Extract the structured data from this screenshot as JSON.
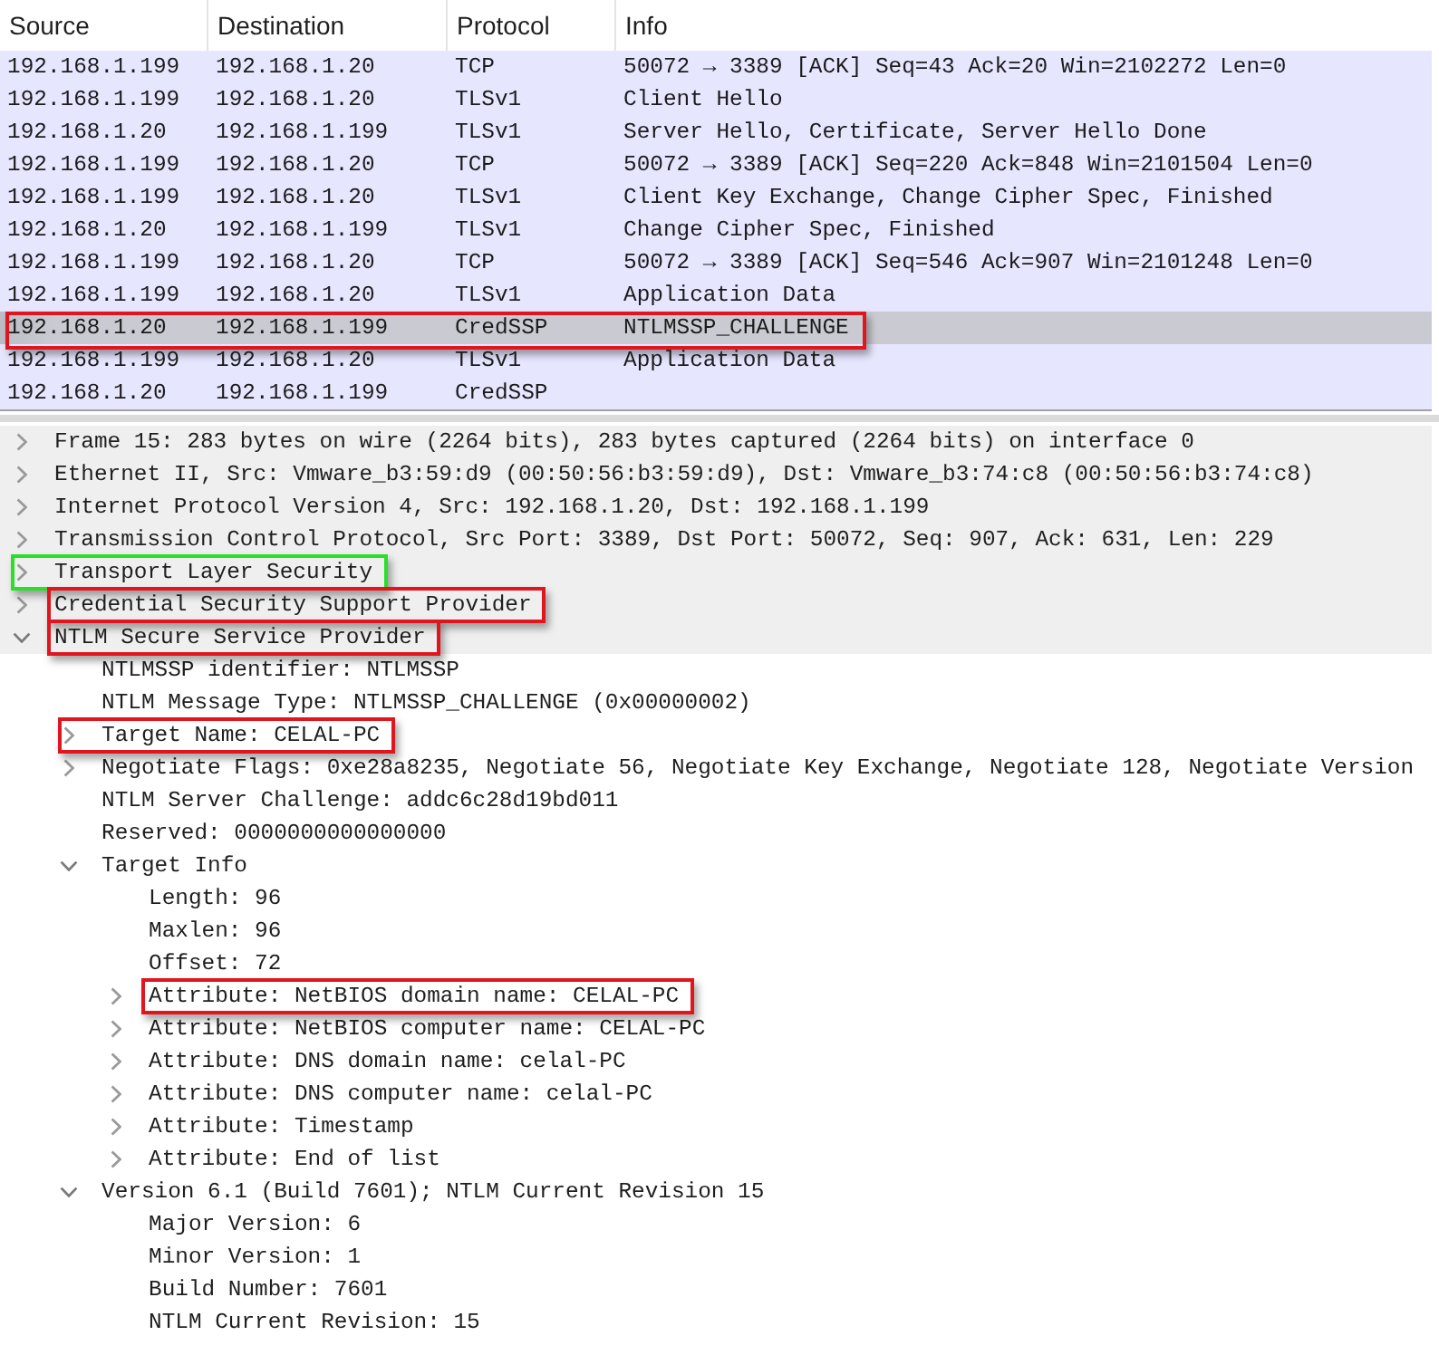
{
  "packet_list": {
    "columns": [
      "Source",
      "Destination",
      "Protocol",
      "Info"
    ],
    "rows": [
      {
        "cells": [
          "192.168.1.199",
          "192.168.1.20",
          "TCP",
          "50072 → 3389 [ACK] Seq=43 Ack=20 Win=2102272 Len=0"
        ],
        "selected": false
      },
      {
        "cells": [
          "192.168.1.199",
          "192.168.1.20",
          "TLSv1",
          "Client Hello"
        ],
        "selected": false
      },
      {
        "cells": [
          "192.168.1.20",
          "192.168.1.199",
          "TLSv1",
          "Server Hello, Certificate, Server Hello Done"
        ],
        "selected": false
      },
      {
        "cells": [
          "192.168.1.199",
          "192.168.1.20",
          "TCP",
          "50072 → 3389 [ACK] Seq=220 Ack=848 Win=2101504 Len=0"
        ],
        "selected": false
      },
      {
        "cells": [
          "192.168.1.199",
          "192.168.1.20",
          "TLSv1",
          "Client Key Exchange, Change Cipher Spec, Finished"
        ],
        "selected": false
      },
      {
        "cells": [
          "192.168.1.20",
          "192.168.1.199",
          "TLSv1",
          "Change Cipher Spec, Finished"
        ],
        "selected": false
      },
      {
        "cells": [
          "192.168.1.199",
          "192.168.1.20",
          "TCP",
          "50072 → 3389 [ACK] Seq=546 Ack=907 Win=2101248 Len=0"
        ],
        "selected": false
      },
      {
        "cells": [
          "192.168.1.199",
          "192.168.1.20",
          "TLSv1",
          "Application Data"
        ],
        "selected": false
      },
      {
        "cells": [
          "192.168.1.20",
          "192.168.1.199",
          "CredSSP",
          "NTLMSSP_CHALLENGE"
        ],
        "selected": true,
        "outline": {
          "color": "#e0161e"
        }
      },
      {
        "cells": [
          "192.168.1.199",
          "192.168.1.20",
          "TLSv1",
          "Application Data"
        ],
        "selected": false
      },
      {
        "cells": [
          "192.168.1.20",
          "192.168.1.199",
          "CredSSP"
        ],
        "selected": false
      }
    ]
  },
  "details": [
    {
      "kind": "branch",
      "label": "Frame 15: 283 bytes on wire (2264 bits), 283 bytes captured (2264 bits) on interface 0",
      "expanded": false,
      "highlighted": true
    },
    {
      "kind": "branch",
      "label": "Ethernet II, Src: Vmware_b3:59:d9 (00:50:56:b3:59:d9), Dst: Vmware_b3:74:c8 (00:50:56:b3:74:c8)",
      "expanded": false,
      "highlighted": true
    },
    {
      "kind": "branch",
      "label": "Internet Protocol Version 4, Src: 192.168.1.20, Dst: 192.168.1.199",
      "expanded": false,
      "highlighted": true
    },
    {
      "kind": "branch",
      "label": "Transmission Control Protocol, Src Port: 3389, Dst Port: 50072, Seq: 907, Ack: 631, Len: 229",
      "expanded": false,
      "highlighted": true
    },
    {
      "kind": "branch",
      "label": "Transport Layer Security",
      "expanded": false,
      "highlighted": true,
      "outline": {
        "color": "#2adf2a",
        "includes_toggle": true
      }
    },
    {
      "kind": "branch",
      "label": "Credential Security Support Provider",
      "expanded": false,
      "highlighted": true,
      "outline": {
        "color": "#e0161e",
        "includes_toggle": false
      }
    },
    {
      "kind": "branch",
      "label": "NTLM Secure Service Provider",
      "expanded": true,
      "highlighted": true,
      "outline": {
        "color": "#e0161e",
        "includes_toggle": false
      },
      "children": [
        {
          "kind": "leaf",
          "label": "NTLMSSP identifier: NTLMSSP",
          "highlighted": false
        },
        {
          "kind": "leaf",
          "label": "NTLM Message Type: NTLMSSP_CHALLENGE (0x00000002)",
          "highlighted": false
        },
        {
          "kind": "branch",
          "label": "Target Name: CELAL-PC",
          "expanded": false,
          "highlighted": false,
          "outline": {
            "color": "#e0161e",
            "includes_toggle": true
          }
        },
        {
          "kind": "branch",
          "label": "Negotiate Flags: 0xe28a8235, Negotiate 56, Negotiate Key Exchange, Negotiate 128, Negotiate Version",
          "expanded": false,
          "highlighted": false
        },
        {
          "kind": "leaf",
          "label": "NTLM Server Challenge: addc6c28d19bd011",
          "highlighted": false
        },
        {
          "kind": "leaf",
          "label": "Reserved: 0000000000000000",
          "highlighted": false
        },
        {
          "kind": "branch",
          "label": "Target Info",
          "expanded": true,
          "highlighted": false,
          "children": [
            {
              "kind": "leaf",
              "label": "Length: 96",
              "highlighted": false
            },
            {
              "kind": "leaf",
              "label": "Maxlen: 96",
              "highlighted": false
            },
            {
              "kind": "leaf",
              "label": "Offset: 72",
              "highlighted": false
            },
            {
              "kind": "branch",
              "label": "Attribute: NetBIOS domain name: CELAL-PC",
              "expanded": false,
              "highlighted": false,
              "outline": {
                "color": "#e0161e",
                "includes_toggle": false
              }
            },
            {
              "kind": "branch",
              "label": "Attribute: NetBIOS computer name: CELAL-PC",
              "expanded": false,
              "highlighted": false
            },
            {
              "kind": "branch",
              "label": "Attribute: DNS domain name: celal-PC",
              "expanded": false,
              "highlighted": false
            },
            {
              "kind": "branch",
              "label": "Attribute: DNS computer name: celal-PC",
              "expanded": false,
              "highlighted": false
            },
            {
              "kind": "branch",
              "label": "Attribute: Timestamp",
              "expanded": false,
              "highlighted": false
            },
            {
              "kind": "branch",
              "label": "Attribute: End of list",
              "expanded": false,
              "highlighted": false
            }
          ]
        },
        {
          "kind": "branch",
          "label": "Version 6.1 (Build 7601); NTLM Current Revision 15",
          "expanded": true,
          "highlighted": false,
          "children": [
            {
              "kind": "leaf",
              "label": "Major Version: 6",
              "highlighted": false
            },
            {
              "kind": "leaf",
              "label": "Minor Version: 1",
              "highlighted": false
            },
            {
              "kind": "leaf",
              "label": "Build Number: 7601",
              "highlighted": false
            },
            {
              "kind": "leaf",
              "label": "NTLM Current Revision: 15",
              "highlighted": false
            }
          ]
        }
      ]
    }
  ]
}
